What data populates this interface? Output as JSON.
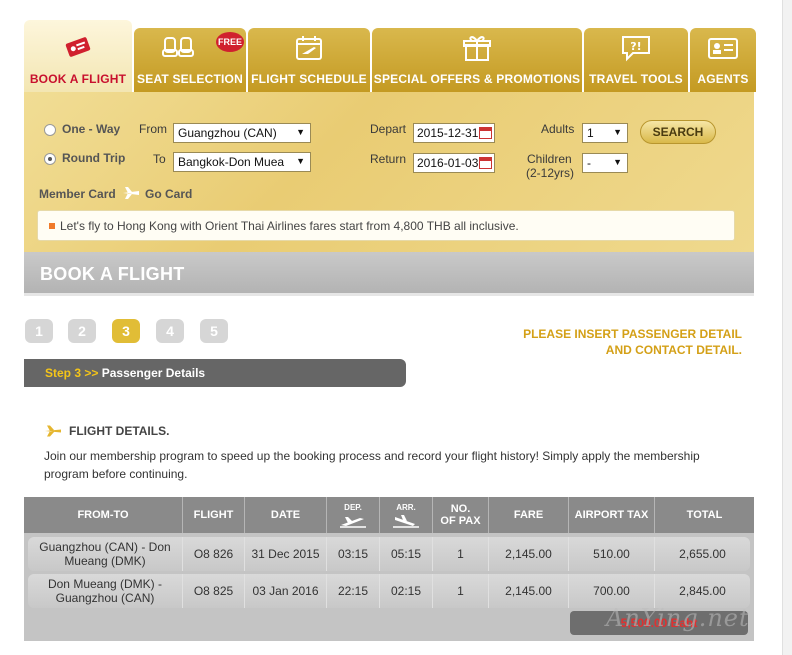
{
  "tabs": [
    {
      "label": "BOOK A FLIGHT",
      "icon": "ticket-icon",
      "active": true
    },
    {
      "label": "SEAT SELECTION",
      "icon": "seat-icon",
      "badge": "FREE"
    },
    {
      "label": "FLIGHT SCHEDULE",
      "icon": "calendar-plane-icon"
    },
    {
      "label": "SPECIAL OFFERS & PROMOTIONS",
      "icon": "gift-icon"
    },
    {
      "label": "TRAVEL TOOLS",
      "icon": "question-bubble-icon"
    },
    {
      "label": "AGENTS",
      "icon": "id-card-icon"
    }
  ],
  "booking": {
    "one_way_label": "One - Way",
    "round_trip_label": "Round Trip",
    "trip_type_selected": "Round Trip",
    "from_label": "From",
    "from_value": "Guangzhou (CAN)",
    "to_label": "To",
    "to_value": "Bangkok-Don Muea",
    "depart_label": "Depart",
    "depart_value": "2015-12-31",
    "return_label": "Return",
    "return_value": "2016-01-03",
    "adults_label": "Adults",
    "adults_value": "1",
    "children_label": "Children",
    "children_sub": "(2-12yrs)",
    "children_value": "-",
    "search_label": "SEARCH",
    "member_card_label": "Member Card",
    "go_card_label": "Go Card",
    "promo_text": "Let's fly to Hong Kong with Orient Thai Airlines fares start from 4,800 THB all inclusive."
  },
  "page_title": "BOOK A FLIGHT",
  "steps": [
    "1",
    "2",
    "3",
    "4",
    "5"
  ],
  "current_step": 3,
  "notice_line1": "PLEASE INSERT PASSENGER DETAIL",
  "notice_line2": "AND CONTACT DETAIL.",
  "step_bar": {
    "step_label": "Step 3 >>",
    "step_name": "Passenger Details"
  },
  "flight_details": {
    "title": "FLIGHT DETAILS.",
    "text": "Join our membership program to speed up the booking process and record your flight history! Simply apply the membership program before continuing."
  },
  "table": {
    "headers": {
      "from_to": "FROM-TO",
      "flight": "FLIGHT",
      "date": "DATE",
      "dep": "DEP.",
      "arr": "ARR.",
      "pax_line1": "NO.",
      "pax_line2": "OF PAX",
      "fare": "FARE",
      "tax": "AIRPORT TAX",
      "total": "TOTAL"
    },
    "rows": [
      {
        "from_to": "Guangzhou (CAN) - Don Mueang (DMK)",
        "flight": "O8 826",
        "date": "31 Dec 2015",
        "dep": "03:15",
        "arr": "05:15",
        "pax": "1",
        "fare": "2,145.00",
        "tax": "510.00",
        "total": "2,655.00"
      },
      {
        "from_to": "Don Mueang (DMK) - Guangzhou (CAN)",
        "flight": "O8 825",
        "date": "03 Jan 2016",
        "dep": "22:15",
        "arr": "02:15",
        "pax": "1",
        "fare": "2,145.00",
        "tax": "700.00",
        "total": "2,845.00"
      }
    ],
    "grand_total": "5,500.00 Baht"
  },
  "watermark": "AnYing.net",
  "colors": {
    "gold": "#d4a017",
    "tab_gold": "#c49a22",
    "active_tab_text": "#c8102e",
    "grey_header": "#8a8a8a"
  }
}
